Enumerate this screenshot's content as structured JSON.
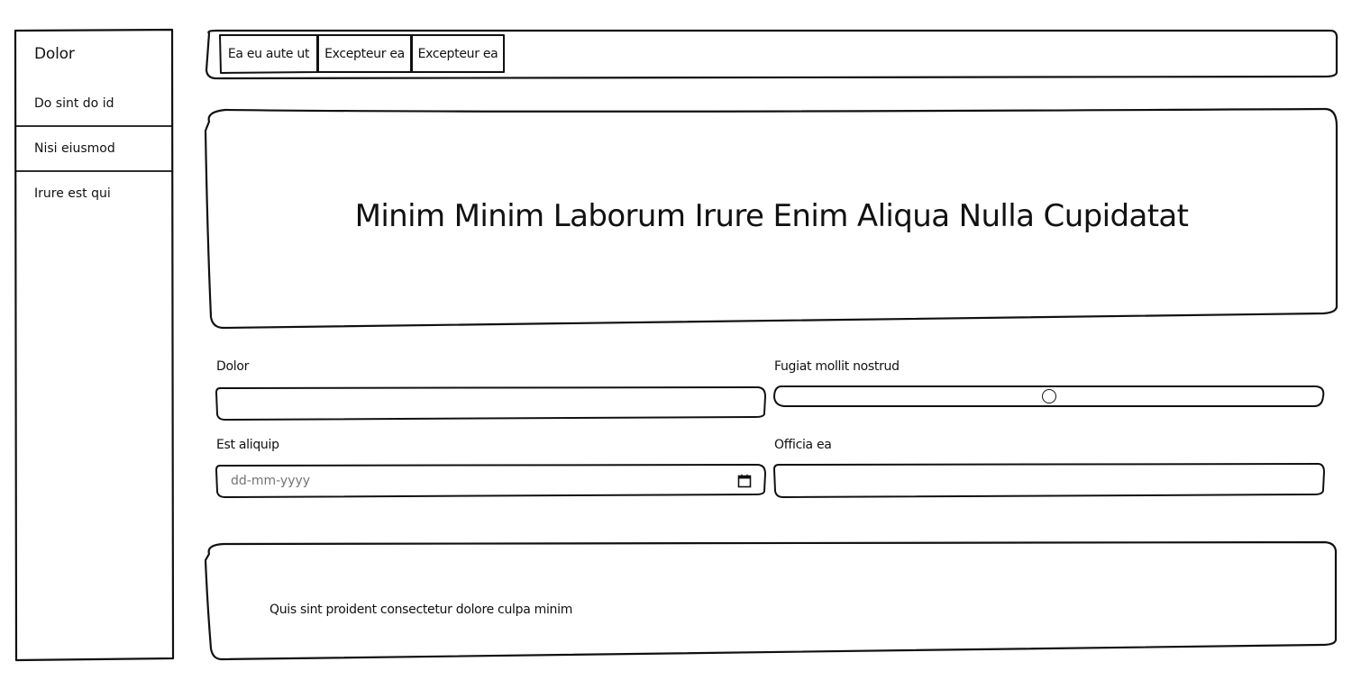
{
  "sidebar": {
    "title": "Dolor",
    "items": [
      {
        "label": "Do sint do id"
      },
      {
        "label": "Nisi eiusmod"
      },
      {
        "label": "Irure est qui"
      }
    ]
  },
  "tabs": [
    {
      "label": "Ea eu aute ut"
    },
    {
      "label": "Excepteur ea"
    },
    {
      "label": "Excepteur ea"
    }
  ],
  "hero": {
    "title": "Minim Minim Laborum Irure Enim Aliqua Nulla Cupidatat"
  },
  "form": {
    "field_1": {
      "label": "Dolor",
      "value": ""
    },
    "slider": {
      "label": "Fugiat mollit nostrud",
      "value": 50
    },
    "date": {
      "label": "Est aliquip",
      "placeholder": "dd-mm-yyyy",
      "icon": "calendar-icon"
    },
    "field_2": {
      "label": "Officia ea",
      "value": ""
    }
  },
  "footer": {
    "text": "Quis sint proident consectetur dolore culpa minim"
  }
}
